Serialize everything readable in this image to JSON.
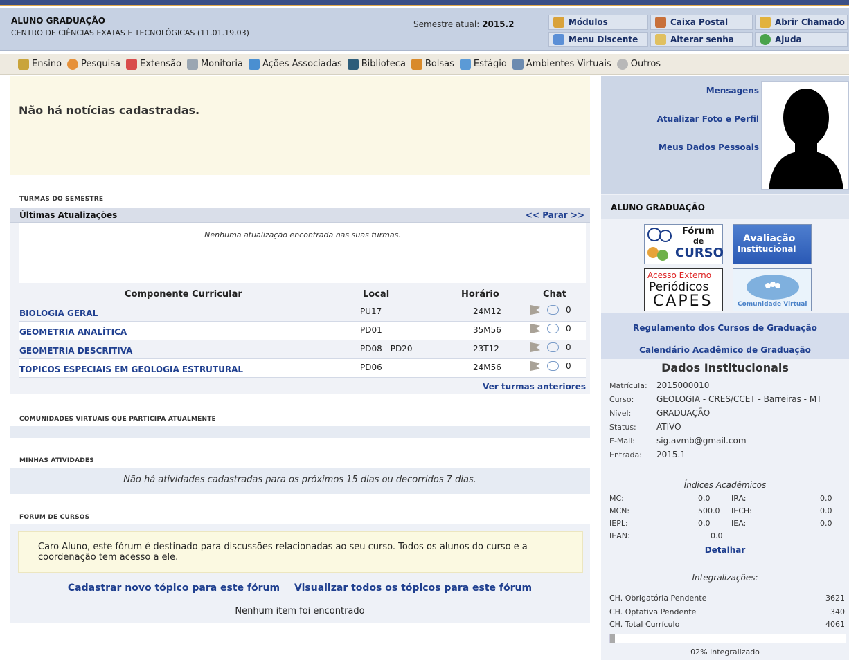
{
  "header": {
    "user_role": "ALUNO GRADUAÇÃO",
    "center": "CENTRO DE CIÊNCIAS EXATAS E TECNOLÓGICAS (11.01.19.03)",
    "semester_label": "Semestre atual:",
    "semester_value": "2015.2",
    "buttons": {
      "modulos": "Módulos",
      "caixa_postal": "Caixa Postal",
      "abrir_chamado": "Abrir Chamado",
      "menu_discente": "Menu Discente",
      "alterar_senha": "Alterar senha",
      "ajuda": "Ajuda"
    }
  },
  "menu": {
    "items": [
      "Ensino",
      "Pesquisa",
      "Extensão",
      "Monitoria",
      "Ações Associadas",
      "Biblioteca",
      "Bolsas",
      "Estágio",
      "Ambientes Virtuais",
      "Outros"
    ]
  },
  "news": {
    "empty_text": "Não há notícias cadastradas."
  },
  "turmas": {
    "section_title": "Turmas do Semestre",
    "updates_title": "Últimas Atualizações",
    "updates_nav": "<< Parar >>",
    "updates_empty": "Nenhuma atualização encontrada nas suas turmas.",
    "columns": [
      "Componente Curricular",
      "Local",
      "Horário",
      "Chat"
    ],
    "rows": [
      {
        "name": "BIOLOGIA GERAL",
        "local": "PU17",
        "horario": "24M12",
        "chat": "0"
      },
      {
        "name": "GEOMETRIA ANALÍTICA",
        "local": "PD01",
        "horario": "35M56",
        "chat": "0"
      },
      {
        "name": "GEOMETRIA DESCRITIVA",
        "local": "PD08 - PD20",
        "horario": "23T12",
        "chat": "0"
      },
      {
        "name": "TOPICOS ESPECIAIS EM GEOLOGIA ESTRUTURAL",
        "local": "PD06",
        "horario": "24M56",
        "chat": "0"
      }
    ],
    "ver_anteriores": "Ver turmas anteriores"
  },
  "comunidades": {
    "section_title": "Comunidades Virtuais que participa atualmente"
  },
  "atividades": {
    "section_title": "Minhas atividades",
    "empty_text": "Não há atividades cadastradas para os próximos 15 dias ou decorridos 7 dias."
  },
  "forum": {
    "section_title": "Forum de Cursos",
    "note": "Caro Aluno, este fórum é destinado para discussões relacionadas ao seu curso. Todos os alunos do curso e a coordenação tem acesso a ele.",
    "link_new": "Cadastrar novo tópico para este fórum",
    "link_all": "Visualizar todos os tópicos para este fórum",
    "empty": "Nenhum item foi encontrado"
  },
  "profile": {
    "links": [
      "Mensagens",
      "Atualizar Foto e Perfil",
      "Meus Dados Pessoais"
    ],
    "role_label": "ALUNO GRADUAÇÃO",
    "banners": {
      "forum_curso": [
        "Fórum",
        "de",
        "CURSO"
      ],
      "avaliacao": [
        "Avaliação",
        "Institucional"
      ],
      "capes": [
        "Acesso Externo",
        "Periódicos",
        "CAPES"
      ],
      "comunidade": "Comunidade Virtual"
    },
    "regulamento": "Regulamento dos Cursos de Graduação",
    "calendario": "Calendário Acadêmico de Graduação"
  },
  "dados": {
    "title": "Dados Institucionais",
    "fields": [
      {
        "k": "Matrícula:",
        "v": "2015000010"
      },
      {
        "k": "Curso:",
        "v": "GEOLOGIA - CRES/CCET - Barreiras - MT"
      },
      {
        "k": "Nível:",
        "v": "GRADUAÇÃO"
      },
      {
        "k": "Status:",
        "v": "ATIVO"
      },
      {
        "k": "E-Mail:",
        "v": "sig.avmb@gmail.com"
      },
      {
        "k": "Entrada:",
        "v": "2015.1"
      }
    ]
  },
  "indices": {
    "title": "Índices Acadêmicos",
    "rows": [
      {
        "k1": "MC:",
        "v1": "0.0",
        "k2": "IRA:",
        "v2": "0.0"
      },
      {
        "k1": "MCN:",
        "v1": "500.0",
        "k2": "IECH:",
        "v2": "0.0"
      },
      {
        "k1": "IEPL:",
        "v1": "0.0",
        "k2": "IEA:",
        "v2": "0.0"
      },
      {
        "k1": "IEAN:",
        "v1": "0.0",
        "k2": "",
        "v2": ""
      }
    ],
    "detalhar": "Detalhar"
  },
  "integralizacoes": {
    "title": "Integralizações:",
    "rows": [
      {
        "k": "CH. Obrigatória Pendente",
        "v": "3621"
      },
      {
        "k": "CH. Optativa Pendente",
        "v": "340"
      },
      {
        "k": "CH. Total Currículo",
        "v": "4061"
      }
    ],
    "progress_fraction": 0.02,
    "pct_text": "02% Integralizado"
  },
  "colors": {
    "link": "#1f3f8f",
    "header_bg": "#c6d1e3",
    "news_bg": "#fbf8e6"
  }
}
